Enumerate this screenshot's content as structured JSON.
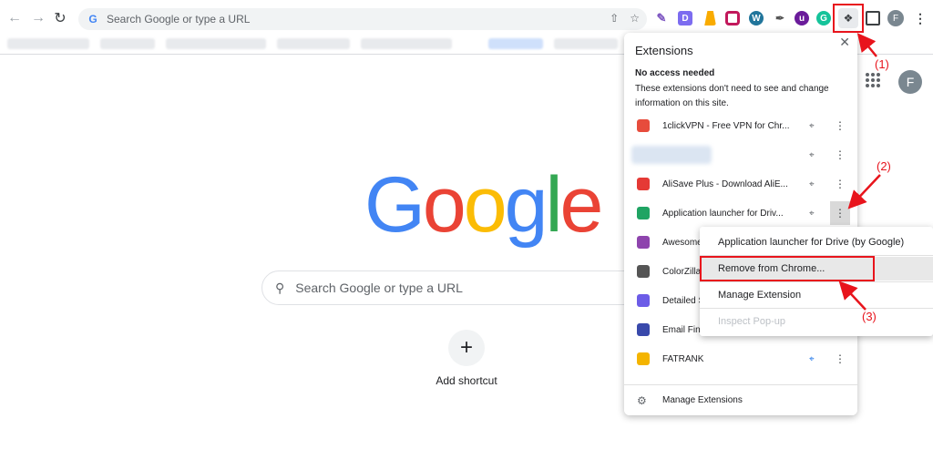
{
  "toolbar": {
    "omnibox_placeholder": "Search Google or type a URL",
    "profile_initial": "F"
  },
  "page": {
    "logo_letters": [
      {
        "ch": "G",
        "color": "#4285F4"
      },
      {
        "ch": "o",
        "color": "#EA4335"
      },
      {
        "ch": "o",
        "color": "#FBBC05"
      },
      {
        "ch": "g",
        "color": "#4285F4"
      },
      {
        "ch": "l",
        "color": "#34A853"
      },
      {
        "ch": "e",
        "color": "#EA4335"
      }
    ],
    "search_placeholder": "Search Google or type a URL",
    "add_shortcut_label": "Add shortcut",
    "profile_initial": "F"
  },
  "extensions_panel": {
    "title": "Extensions",
    "section_title": "No access needed",
    "section_desc": "These extensions don't need to see and change information on this site.",
    "items": [
      {
        "name": "1clickVPN - Free VPN for Chr...",
        "icon": "vpn-icon",
        "color": "#e74c3c"
      },
      {
        "name": "",
        "icon": "blurred-icon",
        "color": "#dbe5f2"
      },
      {
        "name": "AliSave Plus - Download AliE...",
        "icon": "alisave-icon",
        "color": "#e53935"
      },
      {
        "name": "Application launcher for Driv...",
        "icon": "drive-icon",
        "color": "#1fa463"
      },
      {
        "name": "Awesome",
        "icon": "awesome-icon",
        "color": "#8e44ad"
      },
      {
        "name": "ColorZilla",
        "icon": "eyedropper-icon",
        "color": "#555555"
      },
      {
        "name": "Detailed S",
        "icon": "detailed-icon",
        "color": "#6c5ce7"
      },
      {
        "name": "Email Find",
        "icon": "email-finder-icon",
        "color": "#3949ab"
      },
      {
        "name": "FATRANK",
        "icon": "fatrank-icon",
        "color": "#f4b400"
      }
    ],
    "footer_label": "Manage Extensions"
  },
  "context_menu": {
    "items": [
      {
        "label": "Application launcher for Drive (by Google)",
        "enabled": true
      },
      {
        "label": "Remove from Chrome...",
        "enabled": true
      },
      {
        "label": "Manage Extension",
        "enabled": true
      },
      {
        "label": "Inspect Pop-up",
        "enabled": false
      }
    ]
  },
  "annotations": {
    "step1": "(1)",
    "step2": "(2)",
    "step3": "(3)",
    "color": "#e8141c"
  }
}
